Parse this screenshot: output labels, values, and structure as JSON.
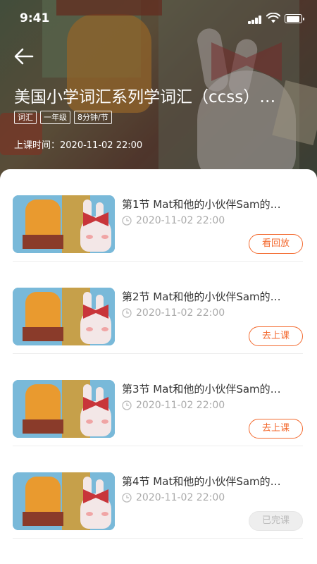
{
  "status_bar": {
    "time": "9:41"
  },
  "course": {
    "title": "美国小学词汇系列学词汇（ccss）…",
    "tags": [
      "词汇",
      "一年级",
      "8分钟/节"
    ],
    "schedule_label": "上课时间：",
    "schedule_value": "2020-11-02 22:00"
  },
  "lessons": [
    {
      "title": "第1节 Mat和他的小伙伴Sam的…",
      "time": "2020-11-02 22:00",
      "action": "看回放",
      "state": "active"
    },
    {
      "title": "第2节 Mat和他的小伙伴Sam的…",
      "time": "2020-11-02 22:00",
      "action": "去上课",
      "state": "active"
    },
    {
      "title": "第3节 Mat和他的小伙伴Sam的…",
      "time": "2020-11-02 22:00",
      "action": "去上课",
      "state": "active"
    },
    {
      "title": "第4节 Mat和他的小伙伴Sam的…",
      "time": "2020-11-02 22:00",
      "action": "已完课",
      "state": "done"
    }
  ],
  "colors": {
    "accent": "#f36a2f",
    "done_bg": "#eeeeee",
    "text_secondary": "#aaaaaa"
  },
  "icons": [
    "back-arrow-icon",
    "clock-icon",
    "signal-icon",
    "wifi-icon",
    "battery-icon"
  ]
}
